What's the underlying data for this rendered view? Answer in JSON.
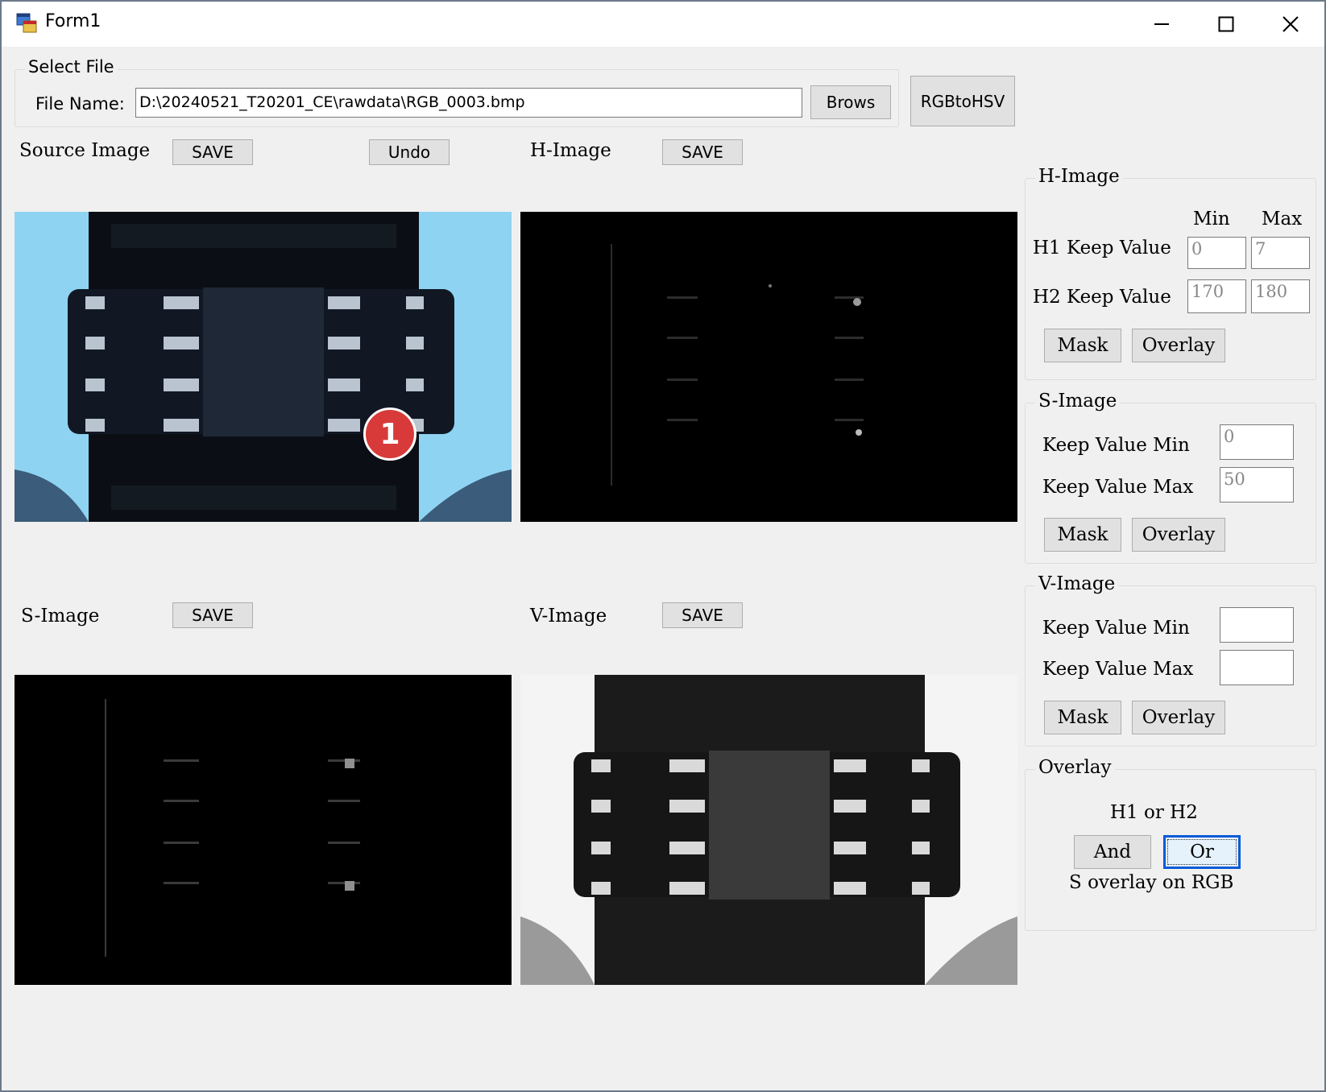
{
  "window": {
    "title": "Form1",
    "icon": "winforms-app-icon",
    "controls": {
      "minimize_icon": "minimize-icon",
      "maximize_icon": "maximize-icon",
      "close_icon": "close-icon"
    }
  },
  "select_file": {
    "group_label": "Select File",
    "file_name_label": "File Name:",
    "file_name_value": "D:\\20240521_T20201_CE\\rawdata\\RGB_0003.bmp",
    "browse_label": "Brows"
  },
  "convert_button_label": "RGBtoHSV",
  "panels": {
    "source": {
      "label": "Source Image",
      "save_label": "SAVE",
      "undo_label": "Undo"
    },
    "h": {
      "label": "H-Image",
      "save_label": "SAVE"
    },
    "s": {
      "label": "S-Image",
      "save_label": "SAVE"
    },
    "v": {
      "label": "V-Image",
      "save_label": "SAVE"
    }
  },
  "marker": {
    "number": "1",
    "color": "#d83a3a"
  },
  "h_group": {
    "title": "H-Image",
    "min_header": "Min",
    "max_header": "Max",
    "h1_label": "H1 Keep Value",
    "h1_min": "0",
    "h1_max": "7",
    "h2_label": "H2 Keep Value",
    "h2_min": "170",
    "h2_max": "180",
    "mask_label": "Mask",
    "overlay_label": "Overlay"
  },
  "s_group": {
    "title": "S-Image",
    "min_label": "Keep Value Min",
    "min_value": "0",
    "max_label": "Keep Value Max",
    "max_value": "50",
    "mask_label": "Mask",
    "overlay_label": "Overlay"
  },
  "v_group": {
    "title": "V-Image",
    "min_label": "Keep Value Min",
    "min_value": "",
    "max_label": "Keep Value Max",
    "max_value": "",
    "mask_label": "Mask",
    "overlay_label": "Overlay"
  },
  "overlay_group": {
    "title": "Overlay",
    "h_caption": "H1 or H2",
    "and_label": "And",
    "or_label": "Or",
    "s_caption": "S overlay on RGB"
  },
  "colors": {
    "window_bg": "#f0f0f0",
    "source_bg": "#8fd3f2",
    "focus_border": "#0a5bd6"
  }
}
